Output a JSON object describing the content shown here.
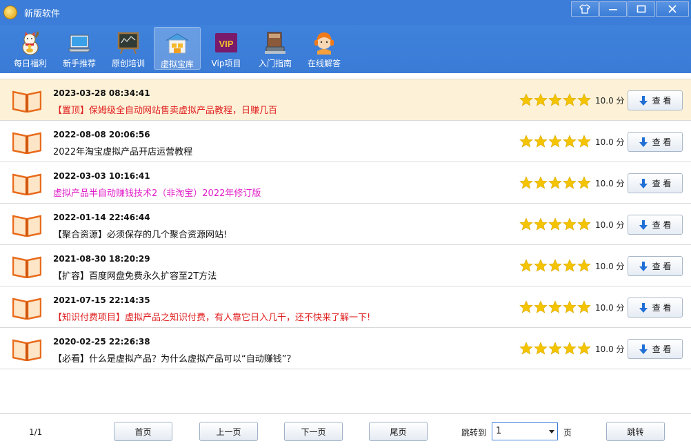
{
  "window": {
    "title": "新版软件"
  },
  "toolbar": {
    "items": [
      {
        "label": "每日福利",
        "icon": "lucky-cat-icon"
      },
      {
        "label": "新手推荐",
        "icon": "laptop-icon"
      },
      {
        "label": "原创培训",
        "icon": "blackboard-icon"
      },
      {
        "label": "虚拟宝库",
        "icon": "treasure-house-icon",
        "active": true
      },
      {
        "label": "Vip项目",
        "icon": "vip-icon"
      },
      {
        "label": "入门指南",
        "icon": "books-icon"
      },
      {
        "label": "在线解答",
        "icon": "support-agent-icon"
      }
    ],
    "vip_text": "VIP"
  },
  "list": {
    "items": [
      {
        "date": "2023-03-28 08:34:41",
        "title": "【置顶】保姆级全自动网站售卖虚拟产品教程，日赚几百",
        "color": "#e02020",
        "pinned": true,
        "rating": 5,
        "score": "10.0 分",
        "action": "查 看"
      },
      {
        "date": "2022-08-08 20:06:56",
        "title": "2022年淘宝虚拟产品开店运营教程",
        "color": "#111111",
        "pinned": false,
        "rating": 5,
        "score": "10.0 分",
        "action": "查 看"
      },
      {
        "date": "2022-03-03 10:16:41",
        "title": "虚拟产品半自动赚钱技术2（非淘宝）2022年修订版",
        "color": "#e020c8",
        "pinned": false,
        "rating": 5,
        "score": "10.0 分",
        "action": "查 看"
      },
      {
        "date": "2022-01-14 22:46:44",
        "title": "【聚合资源】必须保存的几个聚合资源网站!",
        "color": "#111111",
        "pinned": false,
        "rating": 5,
        "score": "10.0 分",
        "action": "查 看"
      },
      {
        "date": "2021-08-30 18:20:29",
        "title": "【扩容】百度网盘免费永久扩容至2T方法",
        "color": "#111111",
        "pinned": false,
        "rating": 5,
        "score": "10.0 分",
        "action": "查 看"
      },
      {
        "date": "2021-07-15 22:14:35",
        "title": "【知识付费项目】虚拟产品之知识付费，有人靠它日入几千，还不快来了解一下!",
        "color": "#e02020",
        "pinned": false,
        "rating": 5,
        "score": "10.0 分",
        "action": "查 看"
      },
      {
        "date": "2020-02-25 22:26:38",
        "title": "【必看】什么是虚拟产品？为什么虚拟产品可以“自动赚钱”？",
        "color": "#111111",
        "pinned": false,
        "rating": 5,
        "score": "10.0 分",
        "action": "查 看"
      }
    ]
  },
  "footer": {
    "page_info": "1/1",
    "first": "首页",
    "prev": "上一页",
    "next": "下一页",
    "last": "尾页",
    "jump_label": "跳转到",
    "jump_value": "1",
    "page_unit": "页",
    "jump_button": "跳转"
  },
  "colors": {
    "titlebar": "#3b7dd8",
    "pinned_row": "#fdf2d8",
    "star": "#f5c400"
  }
}
